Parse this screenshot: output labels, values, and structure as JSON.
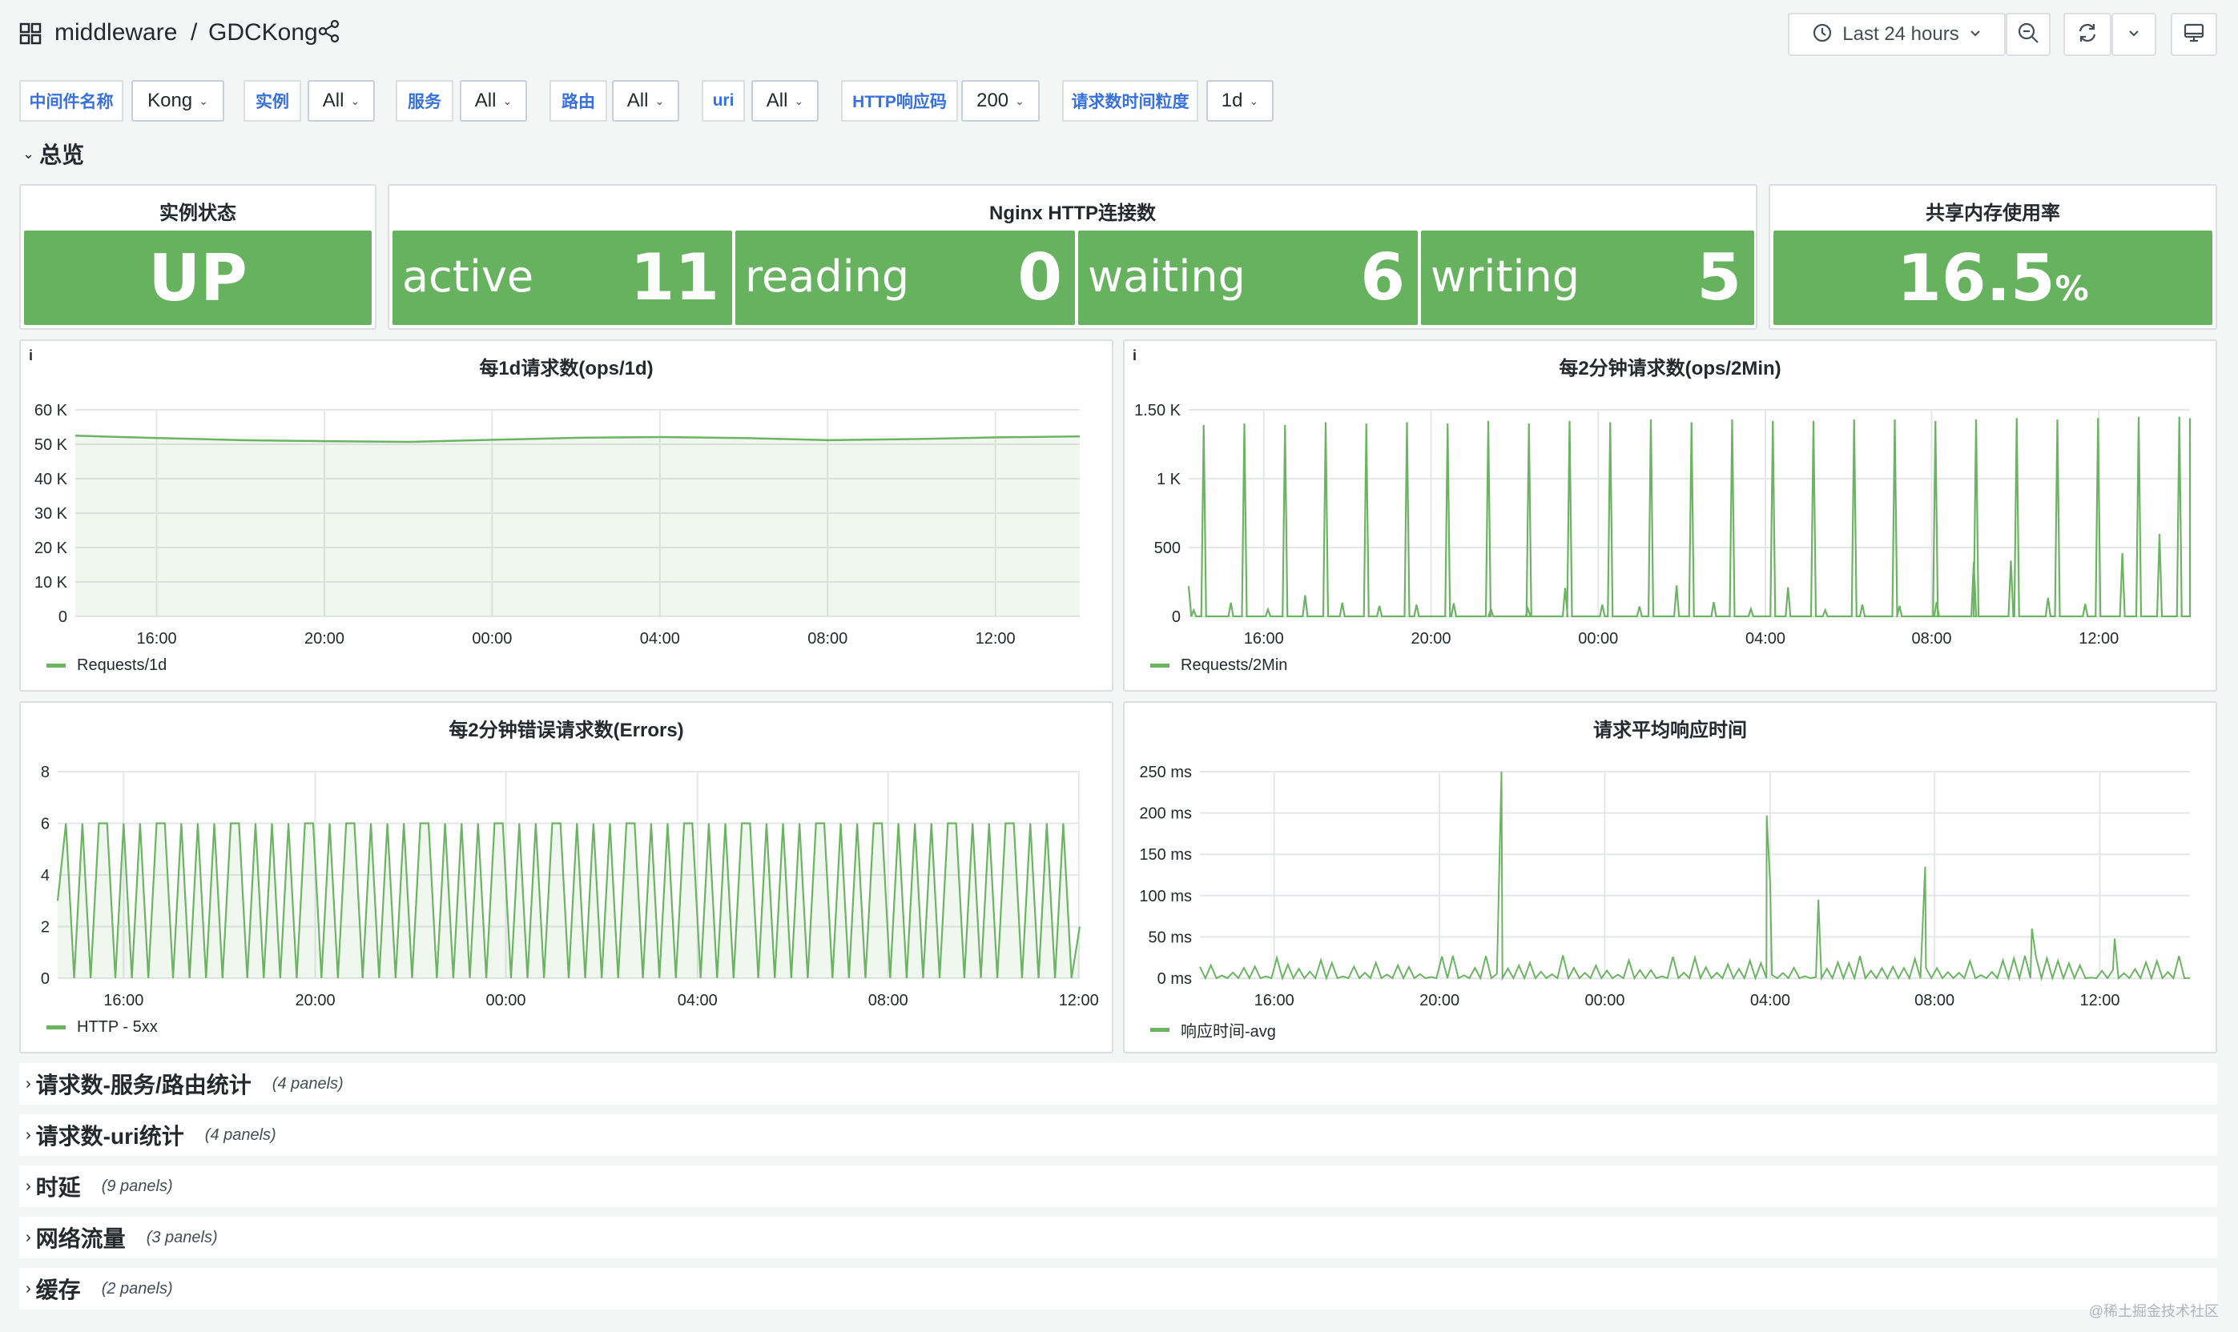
{
  "header": {
    "folder": "middleware",
    "separator": "/",
    "dashboard": "GDCKong",
    "time_range": "Last 24 hours",
    "icons": [
      "apps-icon",
      "share-icon",
      "clock-icon",
      "zoom-out-icon",
      "refresh-icon",
      "chevron-down-icon",
      "tv-icon"
    ]
  },
  "variables": [
    {
      "label": "中间件名称",
      "value": "Kong"
    },
    {
      "label": "实例",
      "value": "All"
    },
    {
      "label": "服务",
      "value": "All"
    },
    {
      "label": "路由",
      "value": "All"
    },
    {
      "label": "uri",
      "value": "All"
    },
    {
      "label": "HTTP响应码",
      "value": "200"
    },
    {
      "label": "请求数时间粒度",
      "value": "1d"
    }
  ],
  "section_overview": "总览",
  "stats": {
    "instance": {
      "title": "实例状态",
      "value": "UP"
    },
    "nginx": {
      "title": "Nginx HTTP连接数",
      "items": [
        {
          "label": "active",
          "value": "11"
        },
        {
          "label": "reading",
          "value": "0"
        },
        {
          "label": "waiting",
          "value": "6"
        },
        {
          "label": "writing",
          "value": "5"
        }
      ]
    },
    "shm": {
      "title": "共享内存使用率",
      "value": "16.5",
      "unit": "%"
    }
  },
  "panels": {
    "p1": {
      "title": "每1d请求数(ops/1d)",
      "legend": "Requests/1d",
      "info": "i"
    },
    "p2": {
      "title": "每2分钟请求数(ops/2Min)",
      "legend": "Requests/2Min",
      "info": "i"
    },
    "p3": {
      "title": "每2分钟错误请求数(Errors)",
      "legend": "HTTP - 5xx"
    },
    "p4": {
      "title": "请求平均响应时间",
      "legend": "响应时间-avg"
    }
  },
  "chart_data": [
    {
      "type": "area",
      "title": "每1d请求数(ops/1d)",
      "x_ticks": [
        "16:00",
        "20:00",
        "00:00",
        "04:00",
        "08:00",
        "12:00"
      ],
      "y_ticks": [
        "0",
        "10 K",
        "20 K",
        "30 K",
        "40 K",
        "50 K",
        "60 K"
      ],
      "ylim": [
        0,
        60000
      ],
      "series": [
        {
          "name": "Requests/1d",
          "x": [
            14.0,
            16,
            18,
            20,
            22,
            0,
            2,
            4,
            6,
            8,
            10,
            12,
            14.0
          ],
          "values": [
            52500,
            51800,
            51200,
            50900,
            50700,
            51300,
            51900,
            52100,
            51800,
            51200,
            51500,
            52000,
            52300
          ]
        }
      ],
      "x_unit": "hour of day"
    },
    {
      "type": "line",
      "title": "每2分钟请求数(ops/2Min)",
      "x_ticks": [
        "16:00",
        "20:00",
        "00:00",
        "04:00",
        "08:00",
        "12:00"
      ],
      "y_ticks": [
        "0",
        "500",
        "1 K",
        "1.50 K"
      ],
      "ylim": [
        0,
        1500
      ],
      "series": [
        {
          "name": "Requests/2Min",
          "peaks": [
            1390,
            1400,
            1390,
            1410,
            1400,
            1410,
            1400,
            1420,
            1400,
            1420,
            1410,
            1430,
            1410,
            1430,
            1420,
            1420,
            1430,
            1430,
            1420,
            1430,
            1440,
            1430,
            1440,
            1450,
            1450
          ],
          "secondary": [
            100,
            220,
            110,
            340,
            220,
            170,
            190,
            210,
            120,
            120,
            460,
            190,
            160,
            500,
            230,
            120,
            470,
            100,
            190,
            170,
            230,
            880,
            900,
            300,
            200,
            1020,
            1330
          ]
        }
      ]
    },
    {
      "type": "line",
      "title": "每2分钟错误请求数(Errors)",
      "x_ticks": [
        "16:00",
        "20:00",
        "00:00",
        "04:00",
        "08:00",
        "12:00"
      ],
      "y_ticks": [
        "0",
        "2",
        "4",
        "6",
        "8"
      ],
      "ylim": [
        0,
        8
      ],
      "series": [
        {
          "name": "HTTP - 5xx",
          "pattern": "oscillates between 0 and 6 approximately every 4 minutes",
          "values": [
            3,
            6,
            0,
            6,
            0,
            6,
            6,
            0,
            6,
            0,
            6,
            0,
            6,
            6,
            0,
            6,
            0,
            6,
            0,
            6,
            0,
            6,
            6,
            0,
            6,
            0,
            6,
            0,
            6,
            0,
            6,
            6,
            0,
            6,
            0,
            6,
            6,
            0,
            6,
            0,
            6,
            0,
            6,
            0,
            6,
            6,
            0,
            6,
            0,
            6,
            0,
            6,
            0,
            6,
            6,
            0,
            6,
            0,
            6,
            0,
            6,
            6,
            0,
            6,
            0,
            6,
            0,
            6,
            0,
            6,
            6,
            0,
            6,
            0,
            6,
            0,
            6,
            6,
            0,
            6,
            0,
            6,
            0,
            6,
            6,
            0,
            6,
            0,
            6,
            0,
            6,
            0,
            6,
            6,
            0,
            6,
            0,
            6,
            0,
            6,
            6,
            0,
            6,
            0,
            6,
            0,
            6,
            0,
            6,
            6,
            0,
            6,
            0,
            6,
            0,
            6,
            6,
            0,
            6,
            0,
            6,
            0,
            6,
            0,
            2
          ]
        }
      ]
    },
    {
      "type": "line",
      "title": "请求平均响应时间",
      "x_ticks": [
        "16:00",
        "20:00",
        "00:00",
        "04:00",
        "08:00",
        "12:00"
      ],
      "y_ticks": [
        "0 ms",
        "50 ms",
        "100 ms",
        "150 ms",
        "200 ms",
        "250 ms"
      ],
      "ylim": [
        0,
        250
      ],
      "series": [
        {
          "name": "响应时间-avg",
          "spikes": [
            {
              "x": "21:30",
              "y": 250
            },
            {
              "x": "03:55",
              "y": 197
            },
            {
              "x": "04:00",
              "y": 115
            },
            {
              "x": "07:45",
              "y": 135
            },
            {
              "x": "05:10",
              "y": 95
            },
            {
              "x": "10:20",
              "y": 60
            },
            {
              "x": "12:20",
              "y": 48
            }
          ],
          "baseline": "mostly 0–30 ms"
        }
      ]
    }
  ],
  "rows": [
    {
      "title": "请求数-服务/路由统计",
      "count": "(4 panels)"
    },
    {
      "title": "请求数-uri统计",
      "count": "(4 panels)"
    },
    {
      "title": "时延",
      "count": "(9 panels)"
    },
    {
      "title": "网络流量",
      "count": "(3 panels)"
    },
    {
      "title": "缓存",
      "count": "(2 panels)"
    }
  ],
  "watermark": "@稀土掘金技术社区",
  "colors": {
    "green": "#6cb464",
    "stat": "#66b25f",
    "blue": "#3871dc"
  }
}
